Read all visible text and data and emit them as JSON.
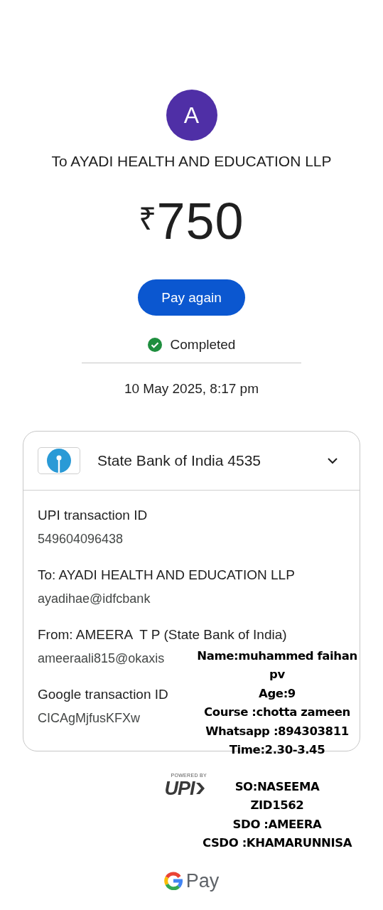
{
  "payee": {
    "initial": "A",
    "title": "To AYADI HEALTH AND EDUCATION LLP"
  },
  "amount": {
    "currency": "₹",
    "value": "750"
  },
  "pay_again_button": "Pay again",
  "status": {
    "kind": "completed",
    "label": "Completed"
  },
  "date": "10 May 2025, 8:17 pm",
  "account": {
    "name": "State Bank of India 4535",
    "expanded": true
  },
  "details": [
    {
      "label": "UPI transaction ID",
      "value": "549604096438"
    },
    {
      "label": "To: AYADI HEALTH AND EDUCATION LLP",
      "value": "ayadihae@idfcbank"
    },
    {
      "label": "From: AMEERA  T P (State Bank of India)",
      "value": "ameeraali815@okaxis"
    },
    {
      "label": "Google transaction ID",
      "value": "CICAgMjfusKFXw"
    }
  ],
  "upi_badge": {
    "powered_by": "POWERED BY",
    "logo": "UPI"
  },
  "footer": {
    "brand": "Pay"
  },
  "annotations": [
    {
      "lines": [
        "Name:muhammed faihan",
        "pv",
        "Age:9",
        "Course :chotta zameen",
        "Whatsapp :894303811",
        "Time:2.30-3.45"
      ]
    },
    {
      "lines": [
        "SO:NASEEMA",
        "ZID1562",
        "SDO :AMEERA",
        "CSDO :KHAMARUNNISA"
      ]
    }
  ]
}
